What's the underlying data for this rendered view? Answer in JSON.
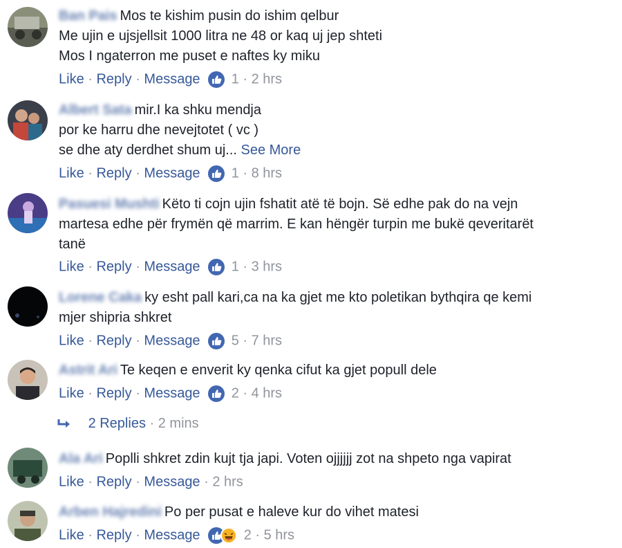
{
  "comments": [
    {
      "author": "Ban Pais",
      "lines": [
        "Mos te kishim pusin do ishim qelbur",
        "Me ujin e ujsjellsit 1000 litra ne 48 or kaq uj jep shteti",
        "Mos I ngaterron me puset e naftes ky miku"
      ],
      "actions": {
        "like": "Like",
        "reply": "Reply",
        "message": "Message"
      },
      "reaction_count": "1",
      "time": "2 hrs"
    },
    {
      "author": "Albert Sata",
      "lines": [
        "mir.I ka shku mendja",
        "por ke harru dhe nevejtotet ( vc )",
        "se dhe aty derdhet shum uj..."
      ],
      "see_more": "See More",
      "actions": {
        "like": "Like",
        "reply": "Reply",
        "message": "Message"
      },
      "reaction_count": "1",
      "time": "8 hrs"
    },
    {
      "author": "Pasuesi Mushti",
      "lines": [
        "Këto ti cojn ujin fshatit atë të bojn. Së edhe pak do na vejn",
        "martesa edhe për frymën që marrim. E kan hëngër turpin me bukë qeveritarët",
        "tanë"
      ],
      "actions": {
        "like": "Like",
        "reply": "Reply",
        "message": "Message"
      },
      "reaction_count": "1",
      "time": "3 hrs"
    },
    {
      "author": "Lorene Caka",
      "lines": [
        "ky esht pall kari,ca na ka gjet me kto poletikan bythqira qe kemi",
        "mjer shipria shkret"
      ],
      "actions": {
        "like": "Like",
        "reply": "Reply",
        "message": "Message"
      },
      "reaction_count": "5",
      "time": "7 hrs"
    },
    {
      "author": "Astrit Ari",
      "lines": [
        "Te keqen e enverit ky qenka cifut ka gjet popull dele"
      ],
      "actions": {
        "like": "Like",
        "reply": "Reply",
        "message": "Message"
      },
      "reaction_count": "2",
      "time": "4 hrs",
      "replies": {
        "label": "2 Replies",
        "time": "2 mins"
      }
    },
    {
      "author": "Ala Ari",
      "lines": [
        "Poplli shkret zdin kujt tja japi. Voten ojjjjjj zot na shpeto nga vapirat"
      ],
      "actions": {
        "like": "Like",
        "reply": "Reply",
        "message": "Message"
      },
      "time": "2 hrs"
    },
    {
      "author": "Arben Hajredini",
      "lines": [
        "Po per pusat e haleve kur do vihet matesi"
      ],
      "actions": {
        "like": "Like",
        "reply": "Reply",
        "message": "Message"
      },
      "reaction_count": "2",
      "time": "5 hrs"
    }
  ],
  "colors": {
    "link": "#365899",
    "meta": "#90949c",
    "text": "#1d2129",
    "like_badge": "#4267b2",
    "haha_badge": "#f7b125"
  },
  "icons": {
    "like": "thumbs-up-icon",
    "haha": "laughing-face-icon",
    "reply_arrow": "reply-arrow-icon"
  }
}
